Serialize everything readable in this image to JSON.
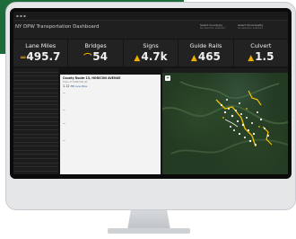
{
  "dashboard": {
    "title": "NY DPW Transportation Dashboard",
    "header_right": [
      {
        "label": "Select County(s)",
        "sub": "No selection selected"
      },
      {
        "label": "Select Municipality",
        "sub": "No selection selected"
      }
    ]
  },
  "kpis": [
    {
      "label": "Lane Miles",
      "value": "495.7",
      "icon": "road-icon"
    },
    {
      "label": "Bridges",
      "value": "54",
      "icon": "bridge-icon"
    },
    {
      "label": "Signs",
      "value": "4.7k",
      "icon": "sign-icon"
    },
    {
      "label": "Guide Rails",
      "value": "465",
      "icon": "guide-rail-icon"
    },
    {
      "label": "Culvert",
      "value": "1.5",
      "icon": "culvert-icon"
    }
  ],
  "detail": {
    "title": "County Route 13, HORICON AVENUE",
    "subtitle": "Town of HORICON (P)",
    "segment_value": "1.12 mi",
    "segment_link": "Lane Miles"
  },
  "colors": {
    "accent": "#f0b000",
    "kpi_bg": "#222222",
    "screen_bg": "#141414",
    "brand_green": "#1d6a3a",
    "map_green": "#233a23"
  }
}
